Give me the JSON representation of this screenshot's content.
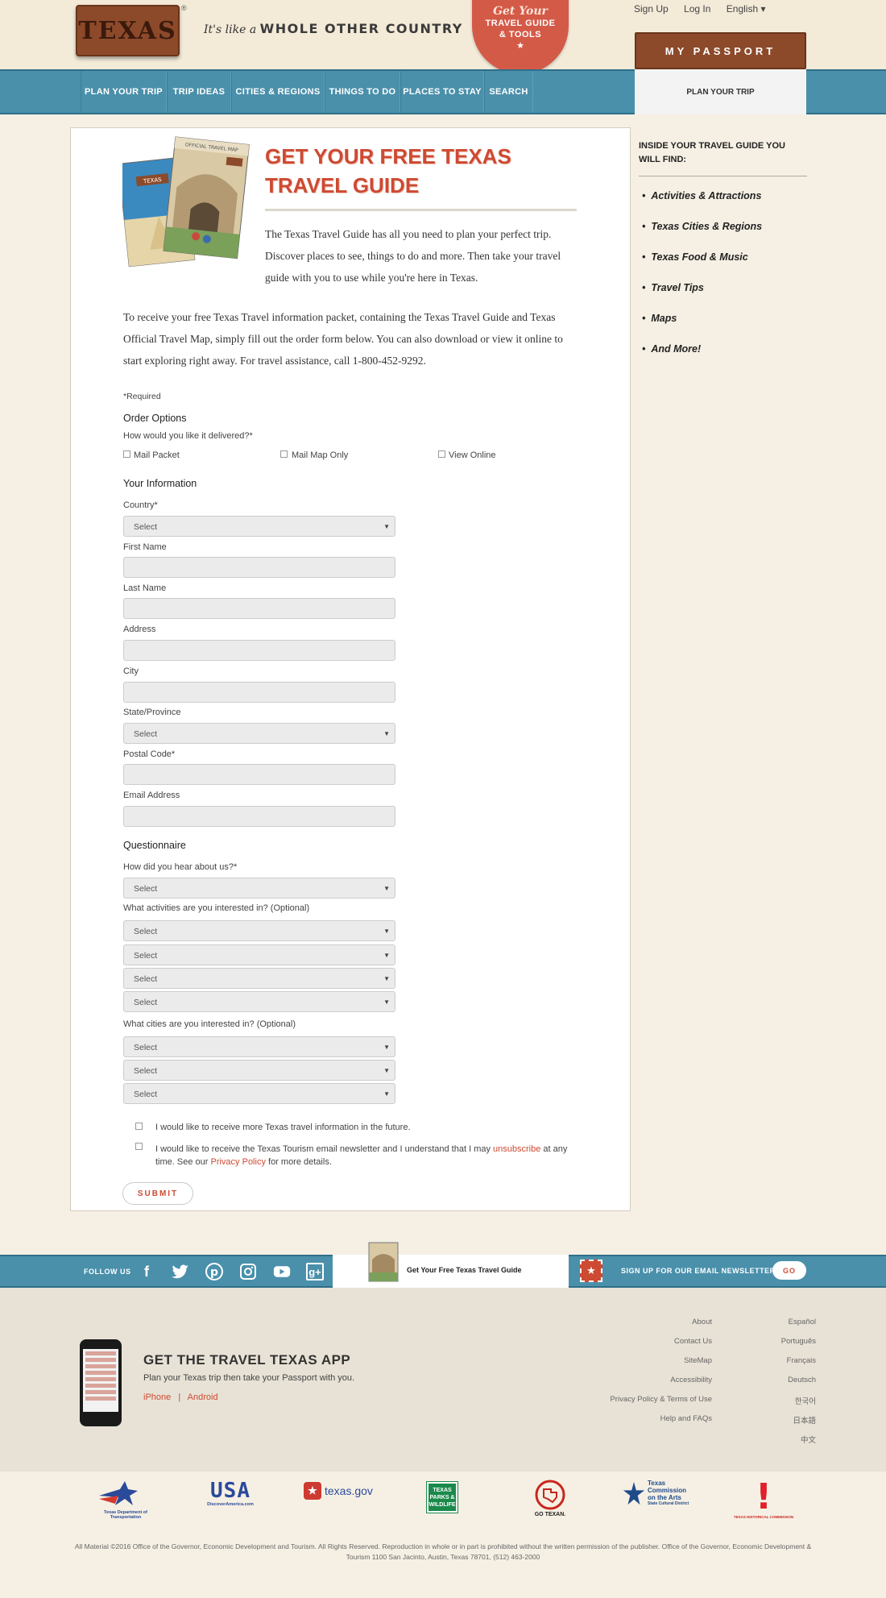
{
  "header": {
    "logo_text": "TEXAS",
    "logo_reg": "®",
    "tagline_small": "It's like a",
    "tagline_big": "WHOLE OTHER COUNTRY",
    "badge": {
      "line1": "Get Your",
      "line2": "TRAVEL GUIDE",
      "line3": "& TOOLS",
      "star": "★"
    },
    "signup": "Sign Up",
    "login": "Log In",
    "language": "English ▾",
    "passport": "MY PASSPORT"
  },
  "nav": {
    "items": [
      "PLAN YOUR TRIP",
      "TRIP IDEAS",
      "CITIES & REGIONS",
      "THINGS TO DO",
      "PLACES TO STAY",
      "SEARCH"
    ],
    "active_tab": "PLAN YOUR TRIP"
  },
  "main": {
    "guide_map_label": "OFFICIAL TRAVEL MAP",
    "guide_book_label": "TEXAS",
    "title": "GET YOUR FREE TEXAS TRAVEL GUIDE",
    "intro": "The Texas Travel Guide has all you need to plan your perfect trip. Discover places to see, things to do and more. Then take your travel guide with you to use while you're here in Texas.",
    "body": "To receive your free Texas Travel information packet, containing the Texas Travel Guide and Texas Official Travel Map, simply fill out the order form below. You can also download or view it online to start exploring right away. For travel assistance, call 1-800-452-9292."
  },
  "form": {
    "required_note": "*Required",
    "order_heading": "Order Options",
    "delivery_question": "How would you like it delivered?*",
    "delivery_options": [
      "Mail Packet",
      "Mail Map Only",
      "View Online"
    ],
    "info_heading": "Your Information",
    "country_label": "Country*",
    "first_name_label": "First Name",
    "last_name_label": "Last Name",
    "address_label": "Address",
    "city_label": "City",
    "state_label": "State/Province",
    "postal_label": "Postal Code*",
    "email_label": "Email Address",
    "select_placeholder": "Select",
    "questionnaire_heading": "Questionnaire",
    "hear_question": "How did you hear about us?*",
    "activities_question": "What activities are you interested in? (Optional)",
    "cities_question": "What cities are you interested in? (Optional)",
    "optin1": "I would like to receive more Texas travel information in the future.",
    "optin2_pre": "I would like to receive the Texas Tourism email newsletter and I understand that I may ",
    "optin2_link": "unsubscribe",
    "optin2_mid": " at any time. See our ",
    "optin2_policy": "Privacy Policy",
    "optin2_post": " for more details.",
    "submit": "SUBMIT"
  },
  "sidebar": {
    "title": "INSIDE YOUR TRAVEL GUIDE YOU WILL FIND:",
    "items": [
      "Activities & Attractions",
      "Texas Cities & Regions",
      "Texas Food & Music",
      "Travel Tips",
      "Maps",
      "And More!"
    ]
  },
  "footer_band": {
    "follow": "FOLLOW US",
    "social_icons": [
      "facebook-icon",
      "twitter-icon",
      "pinterest-icon",
      "instagram-icon",
      "youtube-icon",
      "google-plus-icon"
    ],
    "guide_link": "Get Your Free Texas Travel Guide",
    "newsletter": "SIGN UP FOR OUR EMAIL NEWSLETTER",
    "go": "GO"
  },
  "footer": {
    "app_title": "GET THE TRAVEL TEXAS APP",
    "app_sub": "Plan your Texas trip then take your Passport with you.",
    "app_iphone": "iPhone",
    "app_sep": "|",
    "app_android": "Android",
    "links": [
      "About",
      "Contact Us",
      "SiteMap",
      "Accessibility",
      "Privacy Policy & Terms of Use",
      "Help and FAQs"
    ],
    "languages": [
      "Español",
      "Português",
      "Français",
      "Deutsch",
      "한국어",
      "日本語",
      "中文"
    ]
  },
  "partners": {
    "txdot": "Texas Department of Transportation",
    "usa_top": "USA",
    "usa_bottom": "DiscoverAmerica.com",
    "texasgov": "texas.gov",
    "tpwd": "TEXAS PARKS & WILDLIFE",
    "gotexan": "GO TEXAN.",
    "arts": "Texas Commission on the Arts",
    "arts_sub": "State Cultural District",
    "thc": "TEXAS HISTORICAL COMMISSION"
  },
  "copyright": "All Material ©2016 Office of the Governor, Economic Development and Tourism. All Rights Reserved. Reproduction in whole or in part is prohibited without the written permission of the publisher. Office of the Governor, Economic Development & Tourism 1100 San Jacinto, Austin, Texas 78701, (512) 463-2000",
  "colors": {
    "accent_red": "#cd4a33",
    "nav_blue": "#4a90ab",
    "leather": "#8c4a2b"
  }
}
